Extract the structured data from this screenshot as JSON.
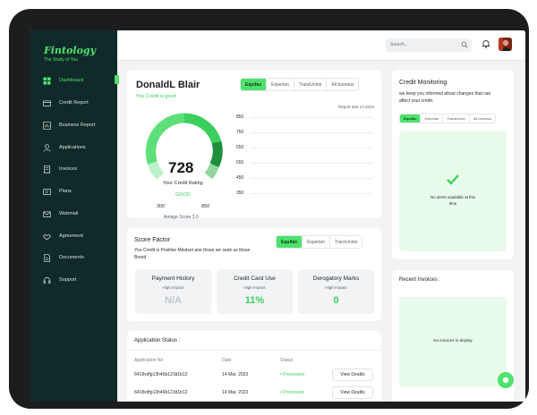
{
  "brand": {
    "name": "Fintology",
    "tagline": "The Study of You"
  },
  "sidebar": {
    "items": [
      {
        "label": "Dashboard",
        "icon": "dashboard-icon",
        "active": true
      },
      {
        "label": "Credit Report",
        "icon": "credit-card-icon"
      },
      {
        "label": "Business Report",
        "icon": "report-icon"
      },
      {
        "label": "Applications",
        "icon": "user-icon"
      },
      {
        "label": "Invoices",
        "icon": "invoice-icon"
      },
      {
        "label": "Plans",
        "icon": "plans-icon"
      },
      {
        "label": "Webmail",
        "icon": "mail-icon"
      },
      {
        "label": "Agreement",
        "icon": "handshake-icon"
      },
      {
        "label": "Documents",
        "icon": "document-icon"
      },
      {
        "label": "Support",
        "icon": "headset-icon"
      }
    ]
  },
  "header": {
    "search_placeholder": "Search..."
  },
  "credit": {
    "name": "DonaldL Blair",
    "subtitle": "You Credit is good",
    "bureaus": [
      "Equifax",
      "Experian",
      "TransUnion",
      "All bureaus"
    ],
    "report_date": "Report Mar 17,2023",
    "score": "728",
    "rating_label": "Your Credit Rating",
    "rating": "GOOD",
    "min": "300",
    "max": "850",
    "antage": "Antage Score 3.0",
    "chart_ticks": [
      "850",
      "750",
      "650",
      "550",
      "450",
      "350"
    ]
  },
  "monitoring": {
    "title": "Credit Monitoring",
    "desc": "we keep you informed about changes that can affect your credit.",
    "bureaus": [
      "Equifax",
      "Experian",
      "TransUnion",
      "All bureaus"
    ],
    "empty": "No alerts available at this time"
  },
  "score_factor": {
    "title": "Score Factor",
    "desc": "You Credit is Positive Mindset ane those we seek as those Breed",
    "bureaus": [
      "Equifax",
      "Experian",
      "TransUnion"
    ],
    "metrics": [
      {
        "title": "Payment History",
        "impact": "High Impact",
        "value": "N/A"
      },
      {
        "title": "Credit Card Use",
        "impact": "High Impact",
        "value": "11%"
      },
      {
        "title": "Derogatory Marks",
        "impact": "High Impact",
        "value": "0"
      }
    ]
  },
  "applications": {
    "title": "Application Status :",
    "columns": [
      "Application No",
      "Date",
      "Status"
    ],
    "rows": [
      {
        "no": "6418vdfg13h46b123d1b12",
        "date": "14 Mar, 2023",
        "status": "Processed",
        "action": "View Deatils"
      },
      {
        "no": "6418vdfg13h46b123d1b12",
        "date": "14 Mar, 2023",
        "status": "Processed",
        "action": "View Deatils"
      }
    ]
  },
  "invoices": {
    "title": "Recent Invoices :",
    "empty": "No invoices to display"
  },
  "colors": {
    "accent": "#4ee26c",
    "sidebar": "#0f2a28",
    "dark_green": "#1f8e3d",
    "light_green": "#b9f2c6"
  }
}
